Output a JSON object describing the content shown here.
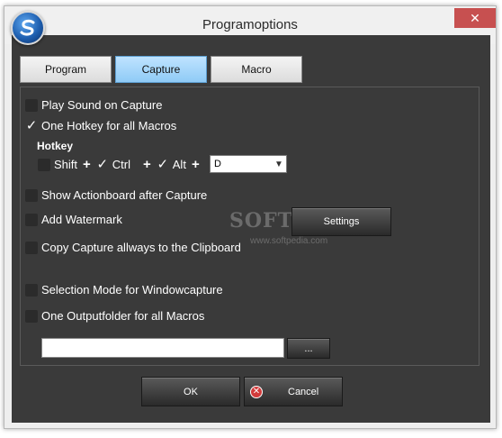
{
  "window": {
    "title": "Programoptions",
    "close_symbol": "✕"
  },
  "tabs": [
    {
      "label": "Program",
      "active": false
    },
    {
      "label": "Capture",
      "active": true
    },
    {
      "label": "Macro",
      "active": false
    }
  ],
  "options": {
    "play_sound": {
      "label": "Play Sound on Capture",
      "checked": false
    },
    "one_hotkey": {
      "label": "One Hotkey for all Macros",
      "checked": true
    },
    "show_actionboard": {
      "label": "Show Actionboard after Capture",
      "checked": false
    },
    "add_watermark": {
      "label": "Add Watermark",
      "checked": false
    },
    "copy_clipboard": {
      "label": "Copy Capture allways to the Clipboard",
      "checked": false
    },
    "selection_mode": {
      "label": "Selection Mode for Windowcapture",
      "checked": false
    },
    "one_outputfolder": {
      "label": "One Outputfolder for all Macros",
      "checked": false
    }
  },
  "hotkey": {
    "title": "Hotkey",
    "shift": {
      "label": "Shift",
      "checked": false
    },
    "ctrl": {
      "label": "Ctrl",
      "checked": true
    },
    "alt": {
      "label": "Alt",
      "checked": true
    },
    "plus": "+",
    "key_value": "D"
  },
  "buttons": {
    "settings": "Settings",
    "browse": "...",
    "ok": "OK",
    "cancel": "Cancel"
  },
  "watermark": {
    "text": "SOFTPEDIA",
    "url": "www.softpedia.com"
  },
  "colors": {
    "active_tab": "#8fcbf6",
    "close_button": "#c75050",
    "panel_background": "#3a3a3a"
  }
}
